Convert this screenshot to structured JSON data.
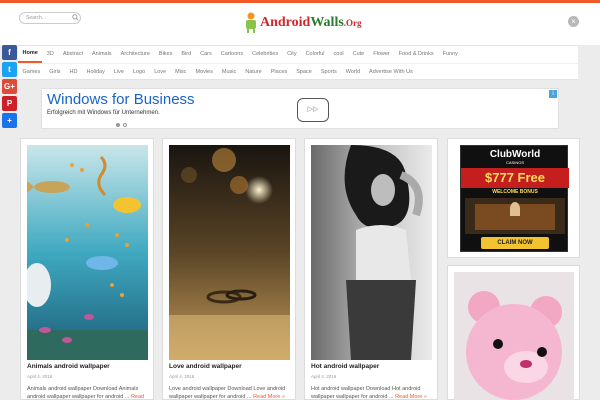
{
  "header": {
    "search_placeholder": "Search...",
    "logo_text_a": "Android",
    "logo_text_b": "Walls",
    "logo_tld": ".Org",
    "close_label": "×"
  },
  "nav": {
    "row1": [
      "Home",
      "3D",
      "Abstract",
      "Animals",
      "Architecture",
      "Bikes",
      "Bird",
      "Cars",
      "Cartoons",
      "Celebrities",
      "City",
      "Colorful",
      "cool",
      "Cute",
      "Flower",
      "Food & Drinks",
      "Funny"
    ],
    "row2": [
      "Games",
      "Girls",
      "HD",
      "Holiday",
      "Live",
      "Logo",
      "Love",
      "Misc",
      "Movies",
      "Music",
      "Nature",
      "Places",
      "Space",
      "Sports",
      "World",
      "Advertise With Us"
    ],
    "active": "Home"
  },
  "social": [
    {
      "name": "facebook",
      "glyph": "f",
      "color": "#3b5998"
    },
    {
      "name": "twitter",
      "glyph": "t",
      "color": "#1da1f2"
    },
    {
      "name": "google-plus",
      "glyph": "G+",
      "color": "#dd4b39"
    },
    {
      "name": "pinterest",
      "glyph": "P",
      "color": "#cb2027"
    },
    {
      "name": "share",
      "glyph": "+",
      "color": "#1a73e8"
    }
  ],
  "ad": {
    "title": "Windows for Business",
    "subtitle": "Erfolgreich mit Windows für Unternehmen.",
    "arrow": "▷▷",
    "info": "i"
  },
  "cards": [
    {
      "title": "Animals android wallpaper",
      "date": "April 4, 2016",
      "desc": "Animals android wallpaper Download Animals android wallpaper wallpaper for android ...",
      "read_more": "Read"
    },
    {
      "title": "Love android wallpaper",
      "date": "April 4, 2016",
      "desc": "Love android wallpaper Download Love android wallpaper wallpaper for android ...",
      "read_more": "Read More »"
    },
    {
      "title": "Hot android wallpaper",
      "date": "April 4, 2016",
      "desc": "Hot android wallpaper Download Hot android wallpaper wallpaper for android ...",
      "read_more": "Read More »"
    }
  ],
  "sidebar_ad": {
    "brand": "ClubWorld",
    "sub": "CASINOS",
    "offer": "$777 Free",
    "bonus": "WELCOME BONUS",
    "cta": "CLAIM NOW"
  },
  "colors": {
    "accent": "#f05a28",
    "link": "#1a63c9"
  }
}
